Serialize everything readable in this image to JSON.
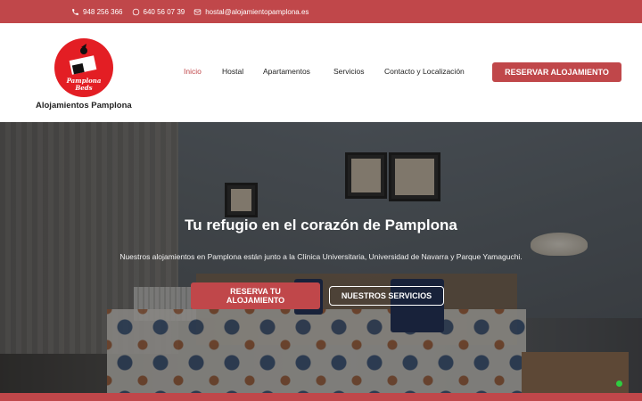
{
  "topbar": {
    "phone1": "948 256 366",
    "phone2": "640 56 07 39",
    "email": "hostal@alojamientopamplona.es",
    "phone_icon": "phone-icon",
    "whatsapp_icon": "whatsapp-icon",
    "email_icon": "email-icon"
  },
  "logo": {
    "line1": "Pamplona",
    "line2": "Beds",
    "brand": "Alojamientos Pamplona"
  },
  "nav": {
    "items": [
      {
        "label": "Inicio",
        "active": true
      },
      {
        "label": "Hostal"
      },
      {
        "label": "Apartamentos"
      },
      {
        "label": "Servicios"
      },
      {
        "label": "Contacto y Localización"
      }
    ],
    "cta": "Reservar Alojamiento"
  },
  "hero": {
    "title": "Tu refugio en el corazón de Pamplona",
    "subtitle": "Nuestros alojamientos en Pamplona están junto a la Clínica Universitaria, Universidad de Navarra y Parque Yamaguchi.",
    "primary_button": "Reserva tu alojamiento",
    "secondary_button": "Nuestros servicios"
  },
  "colors": {
    "accent": "#c0474a",
    "logo_red": "#e31e24",
    "online": "#2ecc40"
  }
}
